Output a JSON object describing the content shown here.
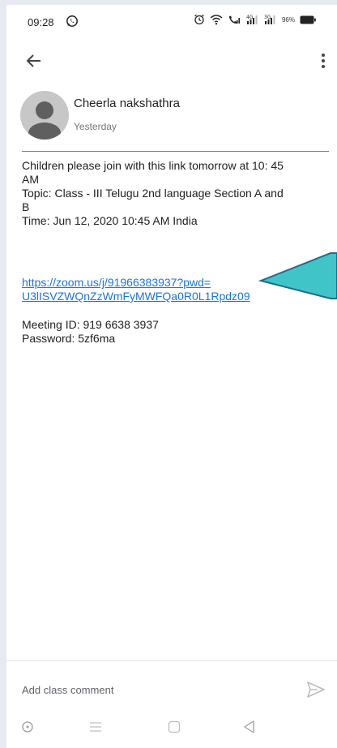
{
  "status_bar": {
    "time": "09:28",
    "battery": "96%"
  },
  "post": {
    "author": "Cheerla nakshathra",
    "time": "Yesterday",
    "body_lines": [
      "Children please join with this link tomorrow at 10: 45",
      "AM",
      "Topic: Class - III Telugu 2nd language Section A and",
      "B",
      "Time: Jun 12, 2020 10:45 AM India"
    ],
    "link_lines": [
      "https://zoom.us/j/91966383937?pwd=",
      "U3lISVZWQnZzWmFyMWFQa0R0L1Rpdz09"
    ],
    "meeting_id": "Meeting ID: 919 6638 3937",
    "password": "Password: 5zf6ma"
  },
  "comment": {
    "placeholder": "Add class comment"
  },
  "colors": {
    "link": "#1a73e8",
    "arrow": "#40c4c8"
  },
  "icons": [
    "whatsapp-icon",
    "alarm-icon",
    "wifi-icon",
    "call-signal-icon",
    "signal-icon",
    "battery-icon",
    "back-arrow-icon",
    "more-vert-icon",
    "avatar-icon",
    "send-icon",
    "nav-circle-icon",
    "nav-menu-icon",
    "nav-home-icon",
    "nav-back-icon"
  ]
}
